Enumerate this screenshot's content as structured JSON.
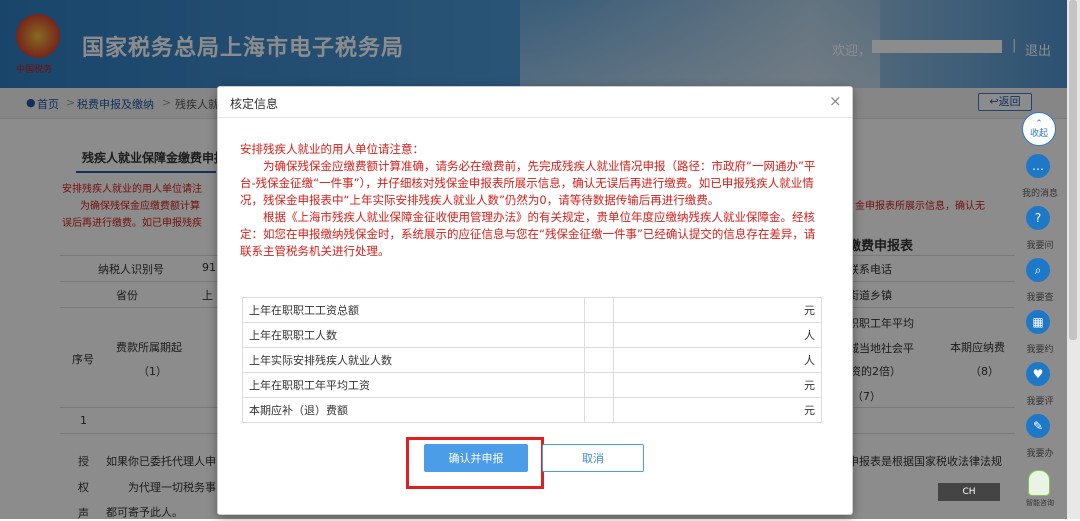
{
  "header": {
    "site_title": "国家税务总局上海市电子税务局",
    "logo_caption": "中国税务",
    "welcome": "欢迎，",
    "separator": "|",
    "logout": "退出"
  },
  "breadcrumb": {
    "home": "首页",
    "sep": ">",
    "level1": "税费申报及缴纳",
    "level2": "残疾人就",
    "back": "返回"
  },
  "background_page": {
    "tab": "残疾人就业保障金缴费申报",
    "red_line1": "安排残疾人就业的用人单位请注",
    "red_line2": "为确保残保金应缴费额计算",
    "red_line3": "误后再进行缴费。如已申报残疾",
    "red_right1": "金申报表所展示信息，确认无",
    "form_title": "缴费申报表",
    "row_taxpayer_id": "纳税人识别号",
    "taxpayer_id_partial": "91",
    "row_province": "省份",
    "province_partial": "上",
    "contact_phone": "联系电话",
    "street_town": "街道乡镇",
    "col_seq": "序号",
    "col_period": "费款所属期起",
    "col_period_no": "（1）",
    "col_avg_wage_1": "职职工年平均",
    "col_avg_wage_2": "城当地社会平",
    "col_avg_wage_3": "资的2倍）",
    "col_avg_wage_no": "（7）",
    "col_payable": "本期应纳费",
    "col_payable_no": "（8）",
    "row_one": "1",
    "auth_char1": "授",
    "auth_char2": "权",
    "auth_char3": "声",
    "auth_text1": "如果你已委托代理人申",
    "auth_text2": "为代理一切税务事",
    "auth_text3": "都可寄予此人。",
    "auth_right": "申报表是根据国家税收法律法规"
  },
  "sidebar": {
    "collapse": "收起",
    "items": [
      {
        "label": "我的消息",
        "icon": "message-icon",
        "glyph": "…"
      },
      {
        "label": "我要问",
        "icon": "question-icon",
        "glyph": "?"
      },
      {
        "label": "我要查",
        "icon": "search-icon",
        "glyph": "⌕"
      },
      {
        "label": "我要约",
        "icon": "calendar-icon",
        "glyph": "▦"
      },
      {
        "label": "我要评",
        "icon": "rate-icon",
        "glyph": "♥"
      },
      {
        "label": "我要办",
        "icon": "edit-icon",
        "glyph": "✎"
      }
    ],
    "bot_caption": "智能咨询"
  },
  "ime": "CH",
  "modal": {
    "title": "核定信息",
    "close": "×",
    "notice_head": "安排残疾人就业的用人单位请注意：",
    "notice_para1": "为确保残保金应缴费额计算准确，请务必在缴费前，先完成残疾人就业情况申报（路径：市政府“一网通办”平台-残保金征缴“一件事”），并仔细核对残保金申报表所展示信息，确认无误后再进行缴费。如已申报残疾人就业情况，残保金申报表中“上年实际安排残疾人就业人数”仍然为0，请等待数据传输后再进行缴费。",
    "notice_para2": "根据《上海市残疾人就业保障金征收使用管理办法》的有关规定，贵单位年度应缴纳残疾人就业保障金。经核定：如您在申报缴纳残保金时，系统展示的应征信息与您在“残保金征缴一件事”已经确认提交的信息存在差异，请联系主管税务机关进行处理。",
    "rows": [
      {
        "label": "上年在职职工工资总额",
        "value": "",
        "unit": "元"
      },
      {
        "label": "上年在职职工人数",
        "value": "",
        "unit": "人"
      },
      {
        "label": "上年实际安排残疾人就业人数",
        "value": "",
        "unit": "人"
      },
      {
        "label": "上年在职职工年平均工资",
        "value": "",
        "unit": "元"
      },
      {
        "label": "本期应补（退）费额",
        "value": "",
        "unit": "元"
      }
    ],
    "confirm": "确认并申报",
    "cancel": "取消"
  },
  "colors": {
    "brand_blue": "#1e5aa8",
    "notice_red": "#d4201b",
    "confirm_bg": "#4a9de6",
    "highlight_red": "#e02020"
  }
}
